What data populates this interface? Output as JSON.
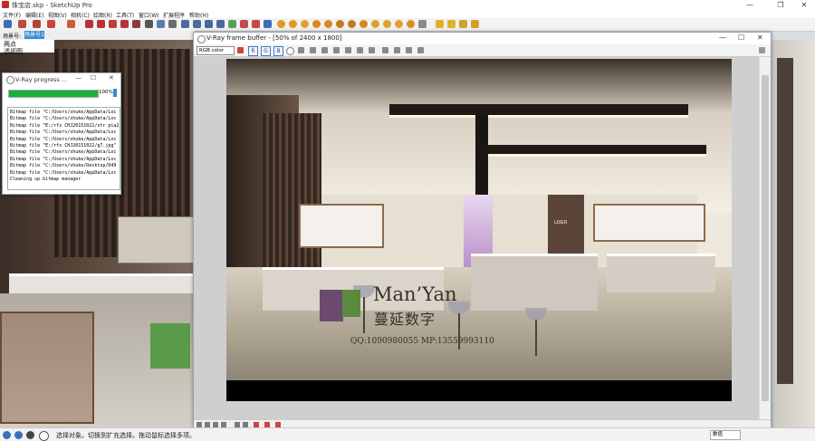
{
  "app": {
    "title": "珠宝店.skp - SketchUp Pro",
    "window_controls": {
      "minimize": "—",
      "restore": "❐",
      "close": "✕"
    }
  },
  "menu": {
    "items": [
      {
        "label": "文件(F)"
      },
      {
        "label": "编辑(E)"
      },
      {
        "label": "视图(V)"
      },
      {
        "label": "相机(C)"
      },
      {
        "label": "绘图(R)"
      },
      {
        "label": "工具(T)"
      },
      {
        "label": "窗口(W)"
      },
      {
        "label": "扩展程序"
      },
      {
        "label": "帮助(H)"
      }
    ]
  },
  "scenes": {
    "label": "场景号:",
    "active_tab": "场景号1"
  },
  "viewport": {
    "view_label_1": "两点",
    "view_label_2": "透视图"
  },
  "progress_window": {
    "title": "V-Ray progress ...",
    "controls": {
      "minimize": "—",
      "restore": "☐",
      "close": "✕"
    },
    "progress_percent": 100,
    "progress_text": "100%",
    "log_lines": [
      "Bitmap file \"C:/Users/shuke/AppData/Loc",
      "Bitmap file \"C:/Users/shuke/AppData/Loc",
      "Bitmap file \"E:/rfx CHJ20151022/str pia2",
      "Bitmap file \"C:/Users/shuke/AppData/Loc",
      "Bitmap file \"C:/Users/shuke/AppData/Loc",
      "Bitmap file \"E:/rfx CHJ20151022/g7.jpg\"",
      "Bitmap file \"C:/Users/shuke/AppData/Loc",
      "Bitmap file \"C:/Users/shuke/AppData/Loc",
      "Bitmap file \"C:/Users/shuke/Desktop/D49",
      "Bitmap file \"C:/Users/shuke/AppData/Loc",
      "Cleaning up bitmap manager"
    ]
  },
  "frame_buffer": {
    "title": "V-Ray frame buffer - [50% of 2400 x 1800]",
    "controls": {
      "minimize": "—",
      "restore": "☐",
      "close": "✕"
    },
    "channel_select": "RGB color",
    "channels": [
      "R",
      "G",
      "B"
    ],
    "render": {
      "logo_sign": "LOGO",
      "watermark_brand": "Man’Yan",
      "watermark_cn": "蔓延数字",
      "watermark_contact": "QQ:1090980055    MP:13559993110"
    }
  },
  "statusbar": {
    "text": "选择对象。切换到扩充选择。拖动鼠标选择多项。",
    "measure_label": "数值"
  },
  "colors": {
    "progress_fill": "#16b13b",
    "accent": "#3c8ad6"
  }
}
